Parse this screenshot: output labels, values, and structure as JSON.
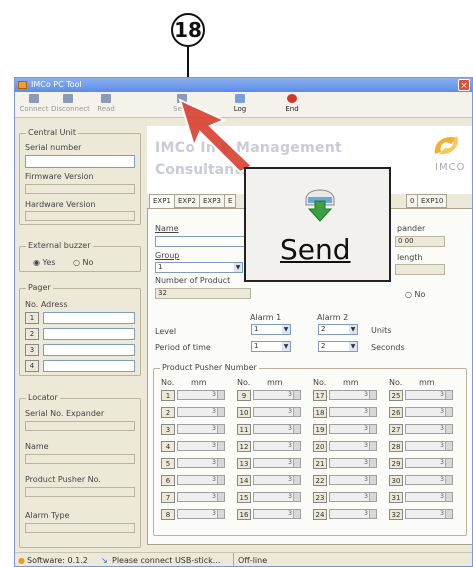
{
  "callout": {
    "number": "18"
  },
  "window": {
    "title": "IMCo PC Tool",
    "close": "×"
  },
  "toolbar": [
    {
      "label": "Connect",
      "active": false
    },
    {
      "label": "Disconnect",
      "active": false
    },
    {
      "label": "Read",
      "active": false
    },
    {
      "label": "Send",
      "active": false
    },
    {
      "label": "Log",
      "active": true
    },
    {
      "label": "End",
      "active": true
    }
  ],
  "central_unit": {
    "title": "Central Unit",
    "serial_label": "Serial number",
    "firmware_label": "Firmware Version",
    "hardware_label": "Hardware Version"
  },
  "buzzer": {
    "title": "External buzzer",
    "yes": "Yes",
    "no": "No"
  },
  "pager": {
    "title": "Pager",
    "header": "No. Adress",
    "rows": [
      "1",
      "2",
      "3",
      "4"
    ]
  },
  "locator": {
    "title": "Locator",
    "serial_label": "Serial No. Expander",
    "name_label": "Name",
    "pusher_label": "Product Pusher No.",
    "alarm_label": "Alarm Type"
  },
  "brand": {
    "line1": "IMCo In        y Management",
    "line2": "Consultants",
    "logo_text": "IMCO"
  },
  "tabs": [
    "EXP1",
    "EXP2",
    "EXP3",
    "E",
    "0",
    "EXP10"
  ],
  "exp": {
    "name_label": "Name",
    "group_label": "Group",
    "group_value": "1",
    "num_products_label": "Number of Product",
    "num_products_value": "32",
    "expander_label": "pander",
    "expander_value": "0 00",
    "length_label": "length",
    "no_label": "No",
    "alarm1": "Alarm 1",
    "alarm2": "Alarm 2",
    "level_label": "Level",
    "period_label": "Period of time",
    "level_a1": "1",
    "level_a2": "2",
    "period_a1": "1",
    "period_a2": "2",
    "units": "Units",
    "seconds": "Seconds",
    "pusher_title": "Product Pusher Number",
    "col_no": "No.",
    "col_mm": "mm",
    "pusher_value": "3",
    "columns": [
      [
        "1",
        "2",
        "3",
        "4",
        "5",
        "6",
        "7",
        "8"
      ],
      [
        "9",
        "10",
        "11",
        "12",
        "13",
        "14",
        "15",
        "16"
      ],
      [
        "17",
        "18",
        "19",
        "20",
        "21",
        "22",
        "23",
        "24"
      ],
      [
        "25",
        "26",
        "27",
        "28",
        "29",
        "30",
        "31",
        "32"
      ]
    ]
  },
  "status": {
    "software": "Software: 0.1.2",
    "message": "Please connect USB-stick...",
    "state": "Off-line"
  },
  "popup": {
    "label": "Send"
  },
  "colors": {
    "title_bar": "#5c8ce6",
    "arrow": "#d84030",
    "send_icon": "#3aa040"
  }
}
